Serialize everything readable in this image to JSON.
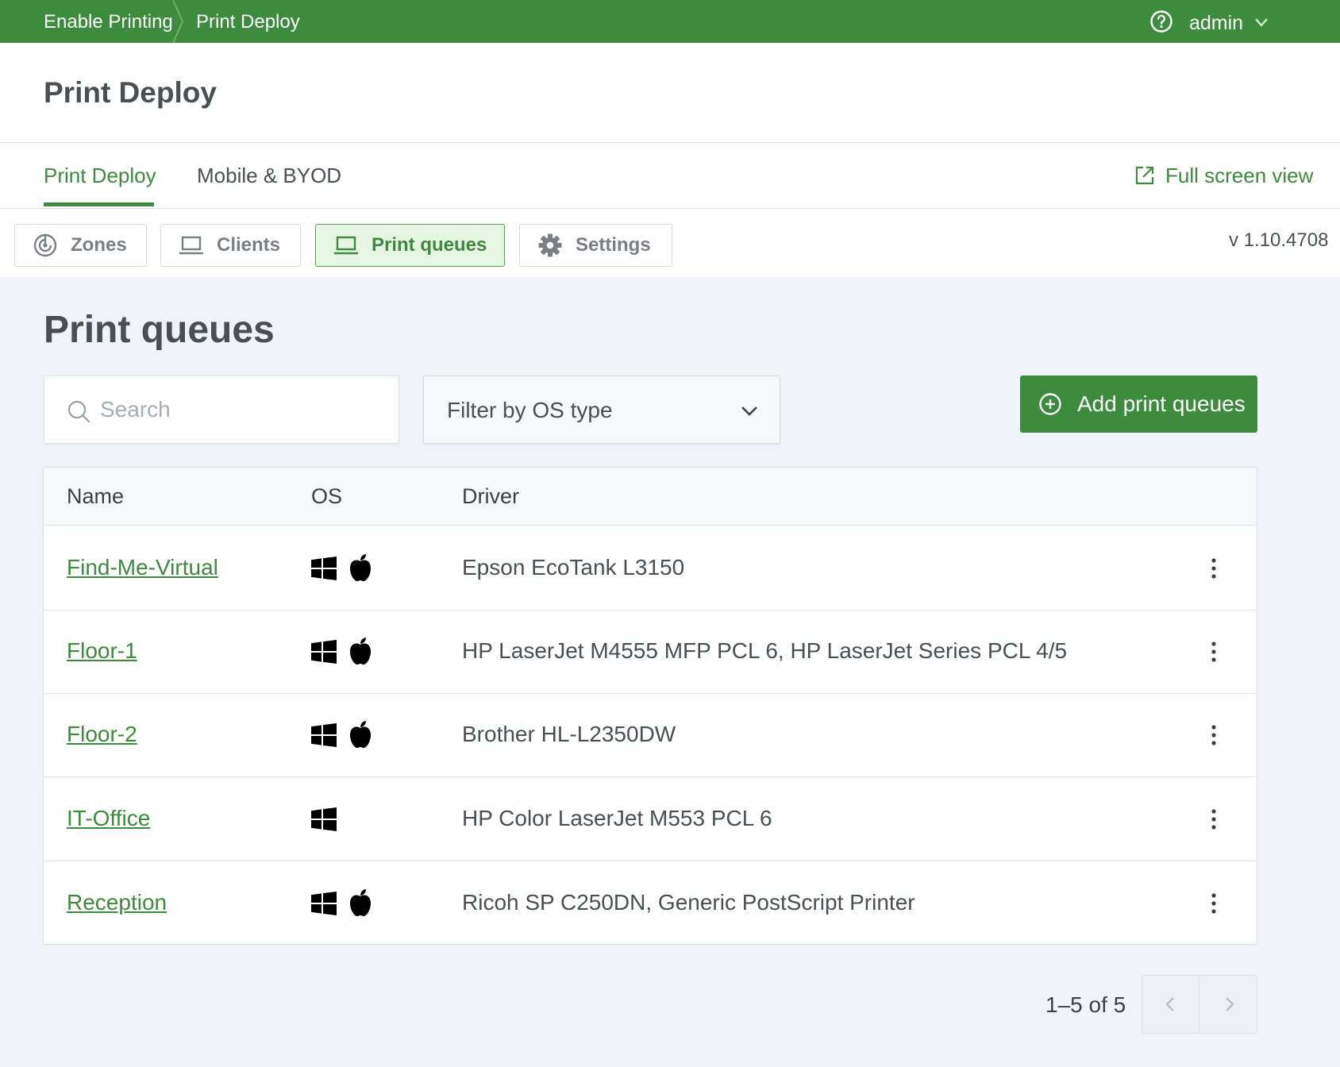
{
  "topbar": {
    "breadcrumb": [
      "Enable Printing",
      "Print Deploy"
    ],
    "user": "admin",
    "help_icon": "help-circle-icon",
    "user_caret_icon": "chevron-down-icon",
    "color": "#3d8b3d"
  },
  "header": {
    "title": "Print Deploy"
  },
  "tabs": {
    "items": [
      {
        "label": "Print Deploy",
        "active": true
      },
      {
        "label": "Mobile & BYOD",
        "active": false
      }
    ],
    "fullscreen_label": "Full screen view",
    "fullscreen_icon": "external-link-icon"
  },
  "subnav": {
    "items": [
      {
        "label": "Zones",
        "icon": "zones-radar-icon",
        "active": false
      },
      {
        "label": "Clients",
        "icon": "laptop-icon",
        "active": false
      },
      {
        "label": "Print queues",
        "icon": "laptop-icon",
        "active": true
      },
      {
        "label": "Settings",
        "icon": "gear-icon",
        "active": false
      }
    ],
    "version": "v 1.10.4708"
  },
  "main": {
    "title": "Print queues",
    "search": {
      "placeholder": "Search",
      "value": "",
      "icon": "search-icon"
    },
    "filter": {
      "label": "Filter by OS type",
      "icon": "chevron-down-icon"
    },
    "add_button": {
      "label": "Add print queues",
      "icon": "plus-circle-icon"
    }
  },
  "table": {
    "columns": [
      "Name",
      "OS",
      "Driver"
    ],
    "rows": [
      {
        "name": "Find-Me-Virtual",
        "os": [
          "windows",
          "mac"
        ],
        "driver": "Epson EcoTank L3150"
      },
      {
        "name": "Floor-1",
        "os": [
          "windows",
          "mac"
        ],
        "driver": "HP LaserJet M4555 MFP PCL 6, HP LaserJet Series PCL 4/5"
      },
      {
        "name": "Floor-2",
        "os": [
          "windows",
          "mac"
        ],
        "driver": "Brother HL-L2350DW"
      },
      {
        "name": "IT-Office",
        "os": [
          "windows"
        ],
        "driver": "HP Color LaserJet M553 PCL 6"
      },
      {
        "name": "Reception",
        "os": [
          "windows",
          "mac"
        ],
        "driver": "Ricoh SP C250DN, Generic PostScript Printer"
      }
    ]
  },
  "pagination": {
    "summary": "1–5 of 5",
    "prev_icon": "chevron-left-icon",
    "next_icon": "chevron-right-icon"
  },
  "colors": {
    "brand": "#3d8b3d",
    "active_tab_bg": "#e7f5e3",
    "page_bg": "#f0f3f7"
  }
}
